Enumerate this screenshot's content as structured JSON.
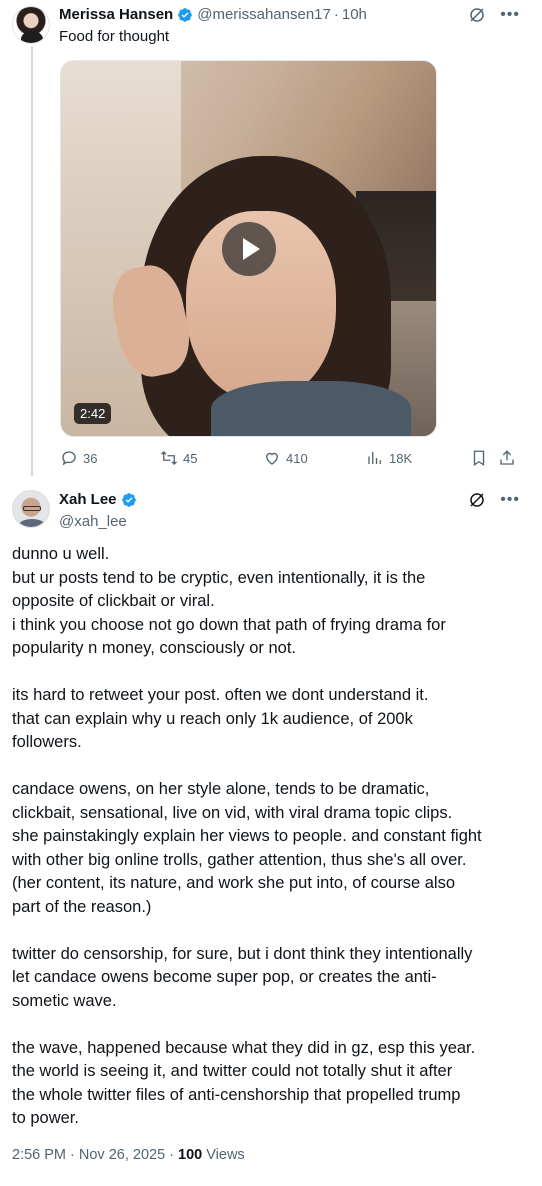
{
  "parent_tweet": {
    "author_name": "Merissa Hansen",
    "handle": "@merissahansen17",
    "separator": "·",
    "time": "10h",
    "text": "Food for thought",
    "video_duration": "2:42",
    "stats": {
      "replies": "36",
      "retweets": "45",
      "likes": "410",
      "views": "18K"
    }
  },
  "main_tweet": {
    "author_name": "Xah Lee",
    "handle": "@xah_lee",
    "paragraphs": [
      [
        "dunno u well.",
        "but ur posts tend to be cryptic, even intentionally, it is the",
        "opposite of clickbait or viral.",
        "i think you choose not go down that path of frying drama for",
        "popularity n money, consciously or not."
      ],
      [
        "its hard to retweet your post. often we dont understand it.",
        "that can explain why u reach only 1k audience, of 200k",
        "followers."
      ],
      [
        "candace owens, on her style alone, tends to be dramatic,",
        "clickbait, sensational, live on vid, with viral drama topic clips.",
        "she painstakingly explain her views to people. and constant fight",
        "with other big online trolls, gather attention, thus she's all over.",
        "(her content, its nature, and work she put into, of course also",
        "part of the reason.)"
      ],
      [
        "twitter do censorship, for sure, but i dont think they intentionally",
        "let candace owens become super pop, or creates the anti-",
        "sometic wave."
      ],
      [
        "the wave, happened because what they did in gz, esp this year.",
        "the world is seeing it, and twitter could not totally shut it after",
        "the whole twitter files of anti-censhorship that propelled trump",
        "to power."
      ]
    ],
    "timestamp": "2:56 PM · Nov 26, 2025 · ",
    "views_count": "100",
    "views_label": " Views"
  },
  "icons": {
    "verified": "verified-badge-icon",
    "grok": "grok-icon",
    "more": "more-icon",
    "reply": "reply-icon",
    "retweet": "retweet-icon",
    "like": "like-icon",
    "views": "views-icon",
    "bookmark": "bookmark-icon",
    "share": "share-icon"
  },
  "colors": {
    "verified_blue": "#1d9bf0",
    "secondary_text": "#536471",
    "primary_text": "#0f1419",
    "thread_line": "#cfd9de"
  }
}
